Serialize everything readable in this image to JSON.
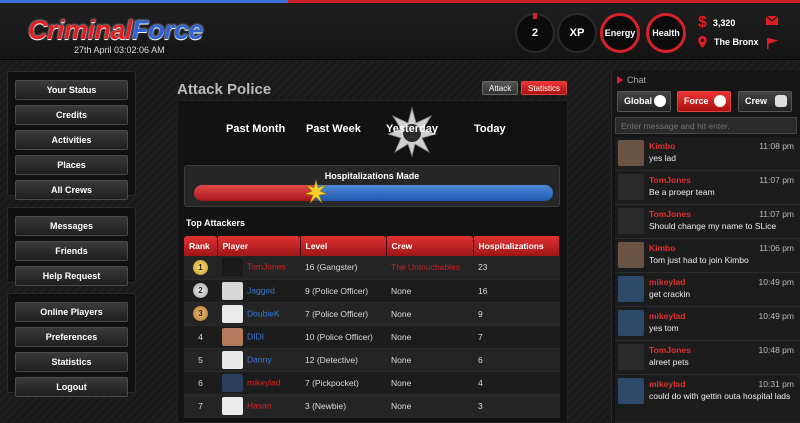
{
  "header": {
    "logo_part1": "Criminal",
    "logo_part2": "Force",
    "date": "27th April 03:02:06 AM",
    "level": "2",
    "xp_label": "XP",
    "energy_label": "Energy",
    "health_label": "Health",
    "money": "3,320",
    "location": "The Bronx"
  },
  "sidebar": {
    "group1": [
      "Your Status",
      "Credits",
      "Activities",
      "Places",
      "All Crews"
    ],
    "group2": [
      "Messages",
      "Friends",
      "Help Request"
    ],
    "group3": [
      "Online Players",
      "Preferences",
      "Statistics",
      "Logout"
    ]
  },
  "main": {
    "title": "Attack Police",
    "tab_attack": "Attack",
    "tab_statistics": "Statistics",
    "periods": [
      "Past Month",
      "Past Week",
      "Yesterday",
      "Today"
    ],
    "hosp_title": "Hospitalizations Made",
    "hosp_red_fraction": 0.34,
    "top_attackers": "Top Attackers",
    "columns": [
      "Rank",
      "Player",
      "Level",
      "Crew",
      "Hospitalizations"
    ],
    "rows": [
      {
        "rank": "1",
        "player": "TomJones",
        "level": "16 (Gangster)",
        "crew": "The Untouchables",
        "hosp": "23"
      },
      {
        "rank": "2",
        "player": "Jagged",
        "level": "9 (Police Officer)",
        "crew": "None",
        "hosp": "16"
      },
      {
        "rank": "3",
        "player": "DoubieK",
        "level": "7 (Police Officer)",
        "crew": "None",
        "hosp": "9"
      },
      {
        "rank": "4",
        "player": "DIDI",
        "level": "10 (Police Officer)",
        "crew": "None",
        "hosp": "7"
      },
      {
        "rank": "5",
        "player": "Danny",
        "level": "12 (Detective)",
        "crew": "None",
        "hosp": "6"
      },
      {
        "rank": "6",
        "player": "mikeylad",
        "level": "7 (Pickpocket)",
        "crew": "None",
        "hosp": "4"
      },
      {
        "rank": "7",
        "player": "Hasan",
        "level": "3 (Newbie)",
        "crew": "None",
        "hosp": "3"
      }
    ]
  },
  "chat": {
    "label": "Chat",
    "btn_global": "Global",
    "btn_force": "Force",
    "btn_crew": "Crew",
    "placeholder": "Enter message and hit enter.",
    "messages": [
      {
        "who": "Kimbo",
        "time": "11:08 pm",
        "text": "yes lad"
      },
      {
        "who": "TomJones",
        "time": "11:07 pm",
        "text": "Be a proepr team"
      },
      {
        "who": "TomJones",
        "time": "11:07 pm",
        "text": "Should change my name to SLice"
      },
      {
        "who": "Kimbo",
        "time": "11:06 pm",
        "text": "Tom just had to join Kimbo"
      },
      {
        "who": "mikeylad",
        "time": "10:49 pm",
        "text": "get crackin"
      },
      {
        "who": "mikeylad",
        "time": "10:49 pm",
        "text": "yes tom"
      },
      {
        "who": "TomJones",
        "time": "10:48 pm",
        "text": "alreet pets"
      },
      {
        "who": "mikeylad",
        "time": "10:31 pm",
        "text": "could do with gettin outa hospital lads"
      }
    ]
  },
  "colors": {
    "red": "#d3222a",
    "blue": "#2f63d6"
  }
}
